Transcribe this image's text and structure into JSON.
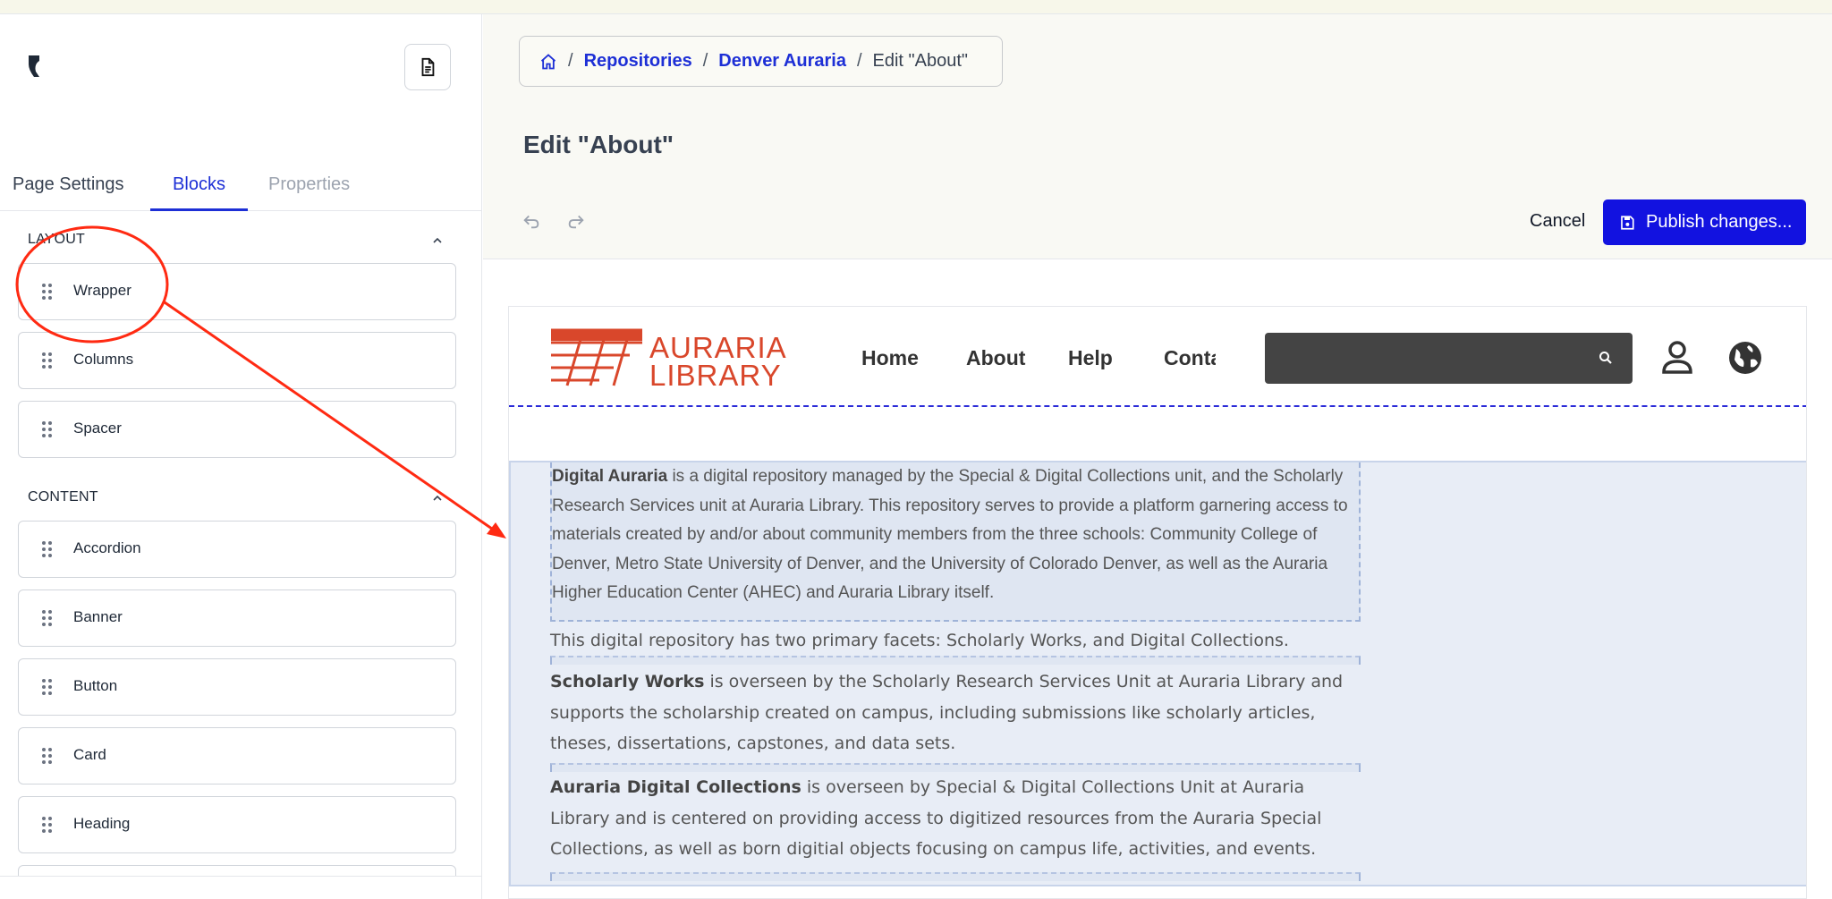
{
  "sidebar": {
    "tabs": [
      "Page Settings",
      "Blocks",
      "Properties"
    ],
    "sections": [
      {
        "title": "LAYOUT",
        "items": [
          "Wrapper",
          "Columns",
          "Spacer"
        ]
      },
      {
        "title": "CONTENT",
        "items": [
          "Accordion",
          "Banner",
          "Button",
          "Card",
          "Heading"
        ]
      }
    ]
  },
  "header": {
    "breadcrumb": {
      "home_icon": "home-icon",
      "items": [
        "Repositories",
        "Denver Auraria"
      ],
      "current": "Edit \"About\""
    },
    "title": "Edit \"About\"",
    "cancel_label": "Cancel",
    "publish_label": "Publish changes..."
  },
  "preview": {
    "logo": {
      "line1": "AURARIA",
      "line2": "LIBRARY"
    },
    "nav": [
      "Home",
      "About",
      "Help",
      "Conta"
    ],
    "paragraphs": [
      {
        "bold": "Digital Auraria",
        "text": " is a digital repository managed by the Special & Digital Collections unit, and the Scholarly Research Services unit at Auraria Library. This repository serves to provide a platform garnering access to materials created by and/or about community members from the three schools: Community College of Denver, Metro State University of Denver, and the University of Colorado Denver, as well as the Auraria Higher Education Center (AHEC) and Auraria Library itself."
      },
      {
        "bold": "",
        "text": "This digital repository has two primary facets: Scholarly Works, and Digital Collections."
      },
      {
        "bold": "Scholarly Works",
        "text": " is overseen by the Scholarly Research Services Unit at Auraria Library and supports the scholarship created on campus, including submissions like scholarly articles, theses, dissertations, capstones, and data sets."
      },
      {
        "bold": "Auraria Digital Collections",
        "text": " is overseen by Special & Digital Collections Unit at Auraria Library and is centered on providing access to digitized resources from the Auraria Special Collections, as well as born digitial objects focusing on campus life, activities, and events."
      }
    ]
  },
  "colors": {
    "accent": "#1212e0",
    "brand": "#d9472b",
    "annotation": "#ff2a12"
  }
}
